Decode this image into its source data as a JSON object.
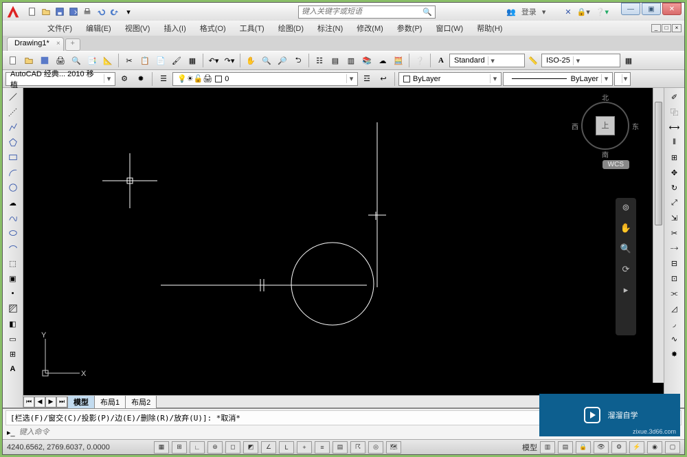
{
  "title": "Drawing1.dwg",
  "search_placeholder": "键入关键字或短语",
  "login_label": "登录",
  "menus": [
    "文件(F)",
    "编辑(E)",
    "视图(V)",
    "插入(I)",
    "格式(O)",
    "工具(T)",
    "绘图(D)",
    "标注(N)",
    "修改(M)",
    "参数(P)",
    "窗口(W)",
    "帮助(H)"
  ],
  "doc_tab": "Drawing1*",
  "text_style": "Standard",
  "dim_style": "ISO-25",
  "workspace_combo": "AutoCAD 经典... 2010 移植",
  "layer_combo": "0",
  "layer_prop": "ByLayer",
  "linetype": "ByLayer",
  "layout_tabs": {
    "model": "模型",
    "l1": "布局1",
    "l2": "布局2"
  },
  "cmd_history": "[栏选(F)/窗交(C)/投影(P)/边(E)/删除(R)/放弃(U)]: *取消*",
  "cmd_placeholder": "键入命令",
  "coords": "4240.6562, 2769.6037, 0.0000",
  "viewcube": {
    "n": "北",
    "s": "南",
    "e": "东",
    "w": "西",
    "top": "上",
    "wcs": "WCS"
  },
  "watermark": {
    "brand": "溜溜自学",
    "url": "zixue.3d66.com"
  }
}
